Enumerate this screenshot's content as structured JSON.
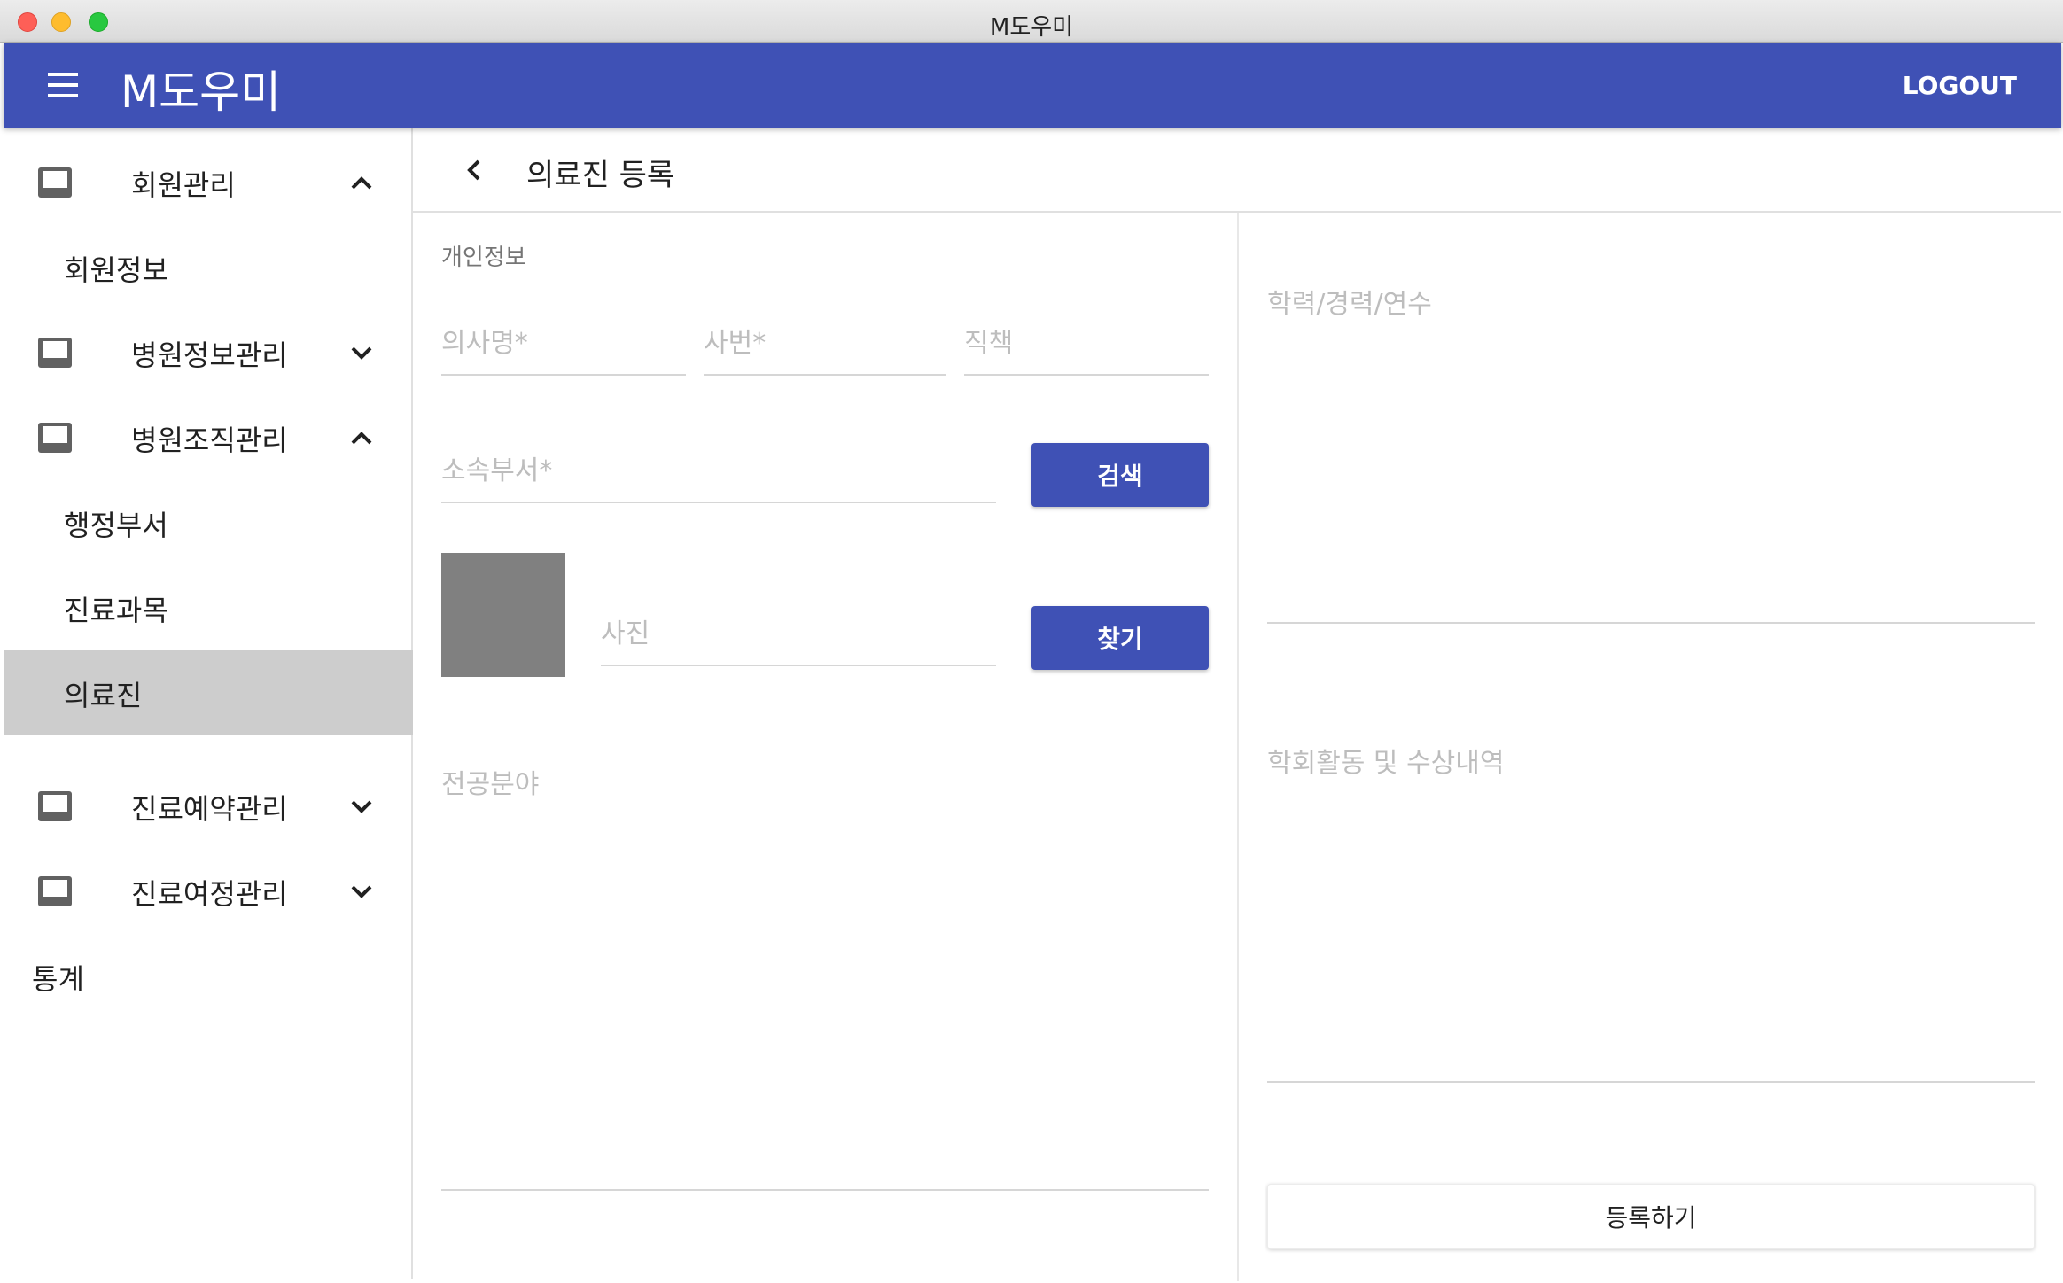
{
  "window": {
    "title": "M도우미"
  },
  "appbar": {
    "title": "M도우미",
    "logout": "LOGOUT"
  },
  "sidebar": {
    "groups": [
      {
        "label": "회원관리",
        "expanded": true,
        "icon": "inbox-icon"
      },
      {
        "label": "병원정보관리",
        "expanded": false,
        "icon": "inbox-icon"
      },
      {
        "label": "병원조직관리",
        "expanded": true,
        "icon": "inbox-icon"
      },
      {
        "label": "진료예약관리",
        "expanded": false,
        "icon": "inbox-icon"
      },
      {
        "label": "진료여정관리",
        "expanded": false,
        "icon": "inbox-icon"
      }
    ],
    "member_info": "회원정보",
    "admin_dept": "행정부서",
    "medical_subject": "진료과목",
    "medical_staff": "의료진",
    "statistics": "통계",
    "active_item": "의료진"
  },
  "header": {
    "title": "의료진 등록",
    "back_icon": "chevron-left-icon"
  },
  "form": {
    "section_label": "개인정보",
    "doctor_name_placeholder": "의사명*",
    "employee_no_placeholder": "사번*",
    "position_placeholder": "직책",
    "department_placeholder": "소속부서*",
    "search_button": "검색",
    "photo_placeholder": "사진",
    "find_button": "찾기",
    "specialty_placeholder": "전공분야",
    "education_placeholder": "학력/경력/연수",
    "activities_placeholder": "학회활동 및 수상내역",
    "submit_button": "등록하기"
  },
  "colors": {
    "primary": "#3f51b5",
    "active_nav": "#cdcdcd",
    "photo_placeholder": "#808080"
  }
}
